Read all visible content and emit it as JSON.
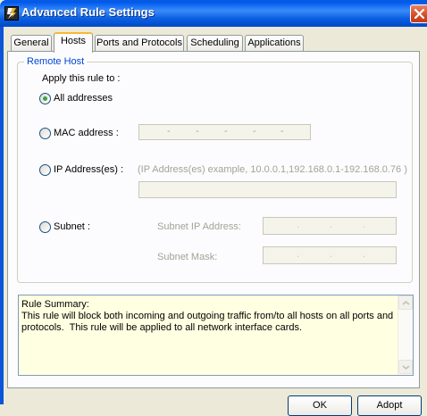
{
  "window": {
    "title": "Advanced Rule Settings",
    "app_icon": "firewall-app-icon",
    "close_icon": "close-icon"
  },
  "tabs": [
    {
      "label": "General"
    },
    {
      "label": "Hosts",
      "active": true
    },
    {
      "label": "Ports and Protocols"
    },
    {
      "label": "Scheduling"
    },
    {
      "label": "Applications"
    }
  ],
  "remote_host": {
    "legend": "Remote Host",
    "apply_label": "Apply this rule to :",
    "options": {
      "all": {
        "label": "All addresses",
        "selected": true
      },
      "mac": {
        "label": "MAC address :",
        "selected": false,
        "segments": [
          "-",
          "-",
          "-",
          "-",
          "-"
        ]
      },
      "ip": {
        "label": "IP Address(es) :",
        "selected": false,
        "example": "(IP Address(es) example, 10.0.0.1,192.168.0.1-192.168.0.76 )",
        "value": ""
      },
      "subnet": {
        "label": "Subnet :",
        "selected": false,
        "ip_label": "Subnet IP Address:",
        "mask_label": "Subnet Mask:",
        "dot": "."
      }
    }
  },
  "summary": {
    "text": "Rule Summary:\nThis rule will block both incoming and outgoing traffic from/to all hosts on all ports and\nprotocols.  This rule will be applied to all network interface cards."
  },
  "buttons": {
    "ok": "OK",
    "adopt": "Adopt"
  },
  "colors": {
    "title_bar": "#0a5fe0",
    "legend": "#0046d5",
    "summary_bg": "#ffffe1",
    "radio_selected": "#3fa33f",
    "close_button": "#d34c25"
  }
}
